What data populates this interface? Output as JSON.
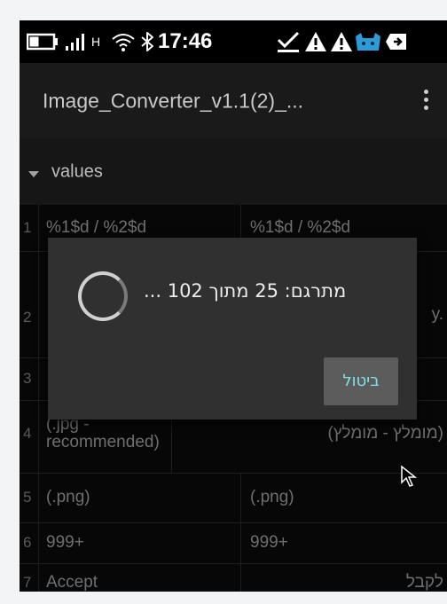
{
  "status_bar": {
    "time": "17:46",
    "battery_icon": "battery-icon",
    "signal_icon": "signal-icon",
    "h_label": "H",
    "wifi_icon": "wifi-icon",
    "bluetooth_icon": "bluetooth-icon",
    "check_icon": "check-icon",
    "warning_icon_1": "warning-icon",
    "warning_icon_2": "warning-icon",
    "android_icon": "android-icon",
    "media_icon": "media-icon"
  },
  "app_bar": {
    "title": "Image_Converter_v1.1(2)_...",
    "menu_icon": "more-vert-icon"
  },
  "section": {
    "label": "values",
    "expand_icon": "expand-arrow-icon"
  },
  "table": {
    "rows": [
      {
        "num": "1",
        "col1": "%1$d / %2$d",
        "col2": "%1$d / %2$d"
      },
      {
        "num": "2",
        "col1": "",
        "col2": "y."
      },
      {
        "num": "3",
        "col1": "",
        "col2": ""
      },
      {
        "num": "4",
        "col1": "(.jpg - recommended)",
        "col2": "(מומלץ - מומלץ)"
      },
      {
        "num": "5",
        "col1": "(.png)",
        "col2": "(.png)"
      },
      {
        "num": "6",
        "col1": "999+",
        "col2": "999+"
      },
      {
        "num": "7",
        "col1": "Accept",
        "col2": "לקבל"
      }
    ]
  },
  "dialog": {
    "message": "מתרגם: 25 מתוך 102 ...",
    "cancel_label": "ביטול",
    "spinner_icon": "progress-spinner-icon"
  },
  "colors": {
    "cancel_text": "#7fe3e6",
    "dialog_bg": "#303030",
    "app_bar_bg": "#1a1a1a"
  }
}
